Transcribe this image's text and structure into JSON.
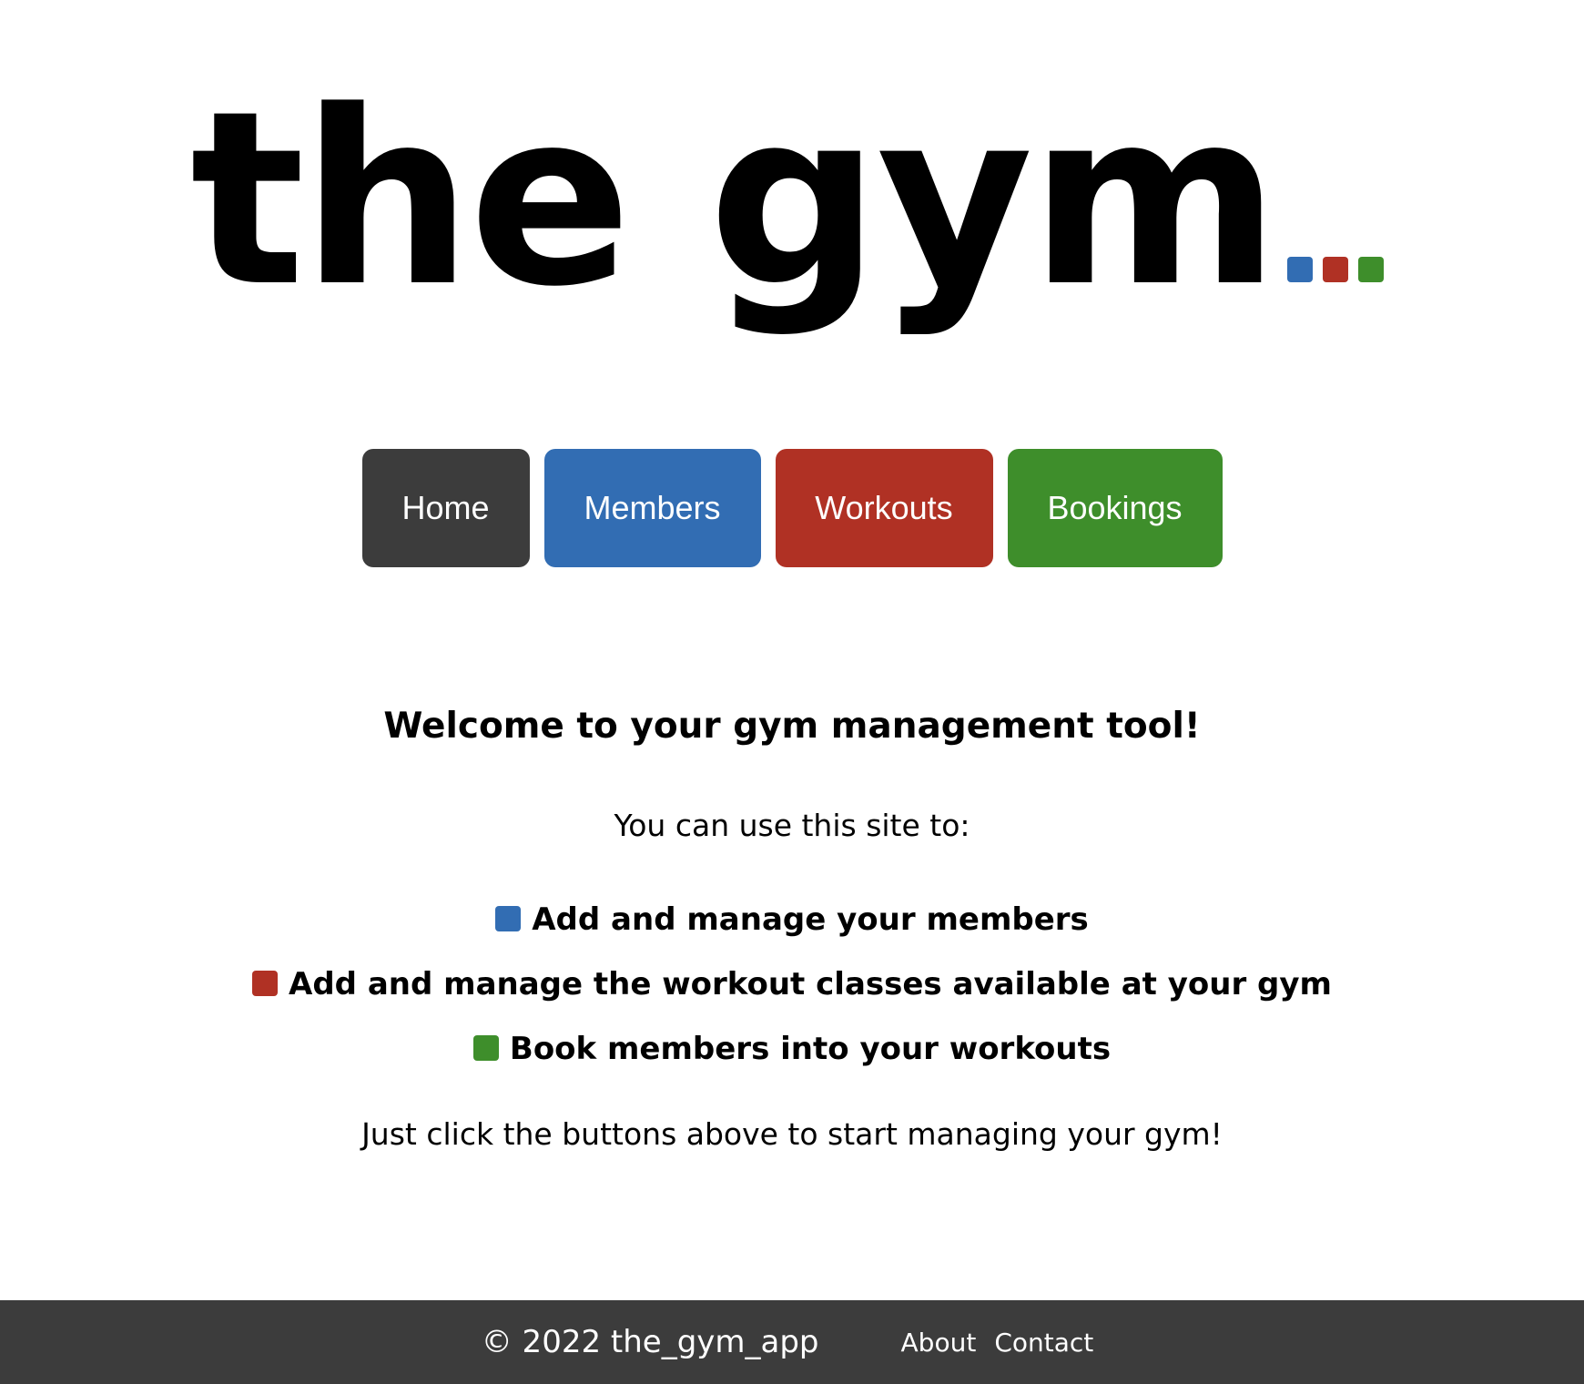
{
  "logo": {
    "text": "the gym",
    "dots": [
      {
        "icon": "blue-square-icon",
        "color": "#326db3"
      },
      {
        "icon": "red-square-icon",
        "color": "#b03124"
      },
      {
        "icon": "green-square-icon",
        "color": "#3e8e2b"
      }
    ]
  },
  "nav": {
    "items": [
      {
        "label": "Home",
        "color": "#3c3c3c"
      },
      {
        "label": "Members",
        "color": "#326db3"
      },
      {
        "label": "Workouts",
        "color": "#b03124"
      },
      {
        "label": "Bookings",
        "color": "#3e8e2b"
      }
    ]
  },
  "main": {
    "heading": "Welcome to your gym management tool!",
    "intro": "You can use this site to:",
    "features": [
      {
        "text": "Add and manage your members",
        "icon": "blue-square-icon",
        "color": "#326db3"
      },
      {
        "text": "Add and manage the workout classes available at your gym",
        "icon": "red-square-icon",
        "color": "#b03124"
      },
      {
        "text": "Book members into your workouts",
        "icon": "green-square-icon",
        "color": "#3e8e2b"
      }
    ],
    "outro": "Just click the buttons above to start managing your gym!"
  },
  "footer": {
    "copyright": "© 2022 the_gym_app",
    "links": [
      "About",
      "Contact"
    ],
    "background": "#3c3c3c"
  }
}
